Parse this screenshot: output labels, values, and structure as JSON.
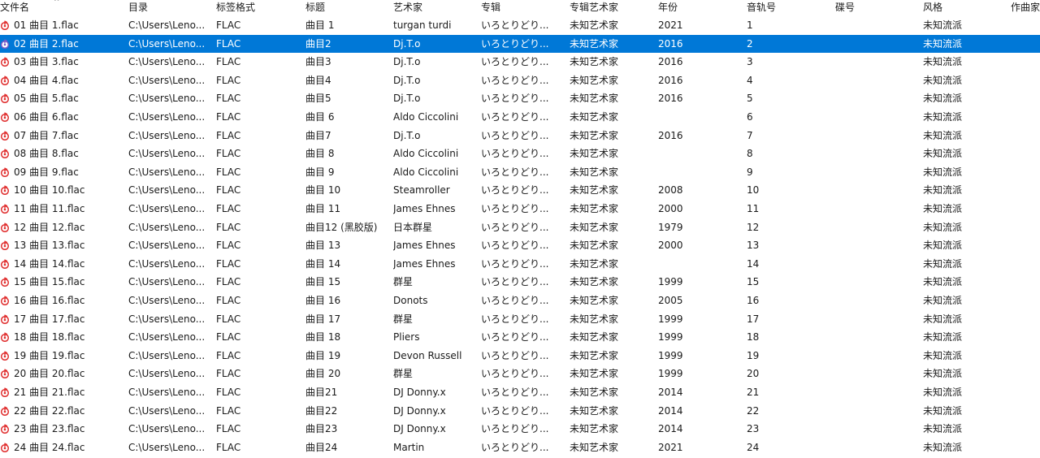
{
  "columns": [
    "文件名",
    "目录",
    "标签格式",
    "标题",
    "艺术家",
    "专辑",
    "专辑艺术家",
    "年份",
    "音轨号",
    "碟号",
    "风格",
    "作曲家"
  ],
  "sort_indicator": "^",
  "icons": {
    "file": "flac-file-icon",
    "file_color": "#e03030",
    "playing_color": "#7a5cc8"
  },
  "colors": {
    "selection": "#0078d7"
  },
  "selected_row": 1,
  "rows": [
    {
      "file": "01 曲目 1.flac",
      "dir": "C:\\Users\\Leno...",
      "fmt": "FLAC",
      "title": "曲目 1",
      "artist": "turgan turdi",
      "album": "いろとりどり...",
      "album_artist": "未知艺术家",
      "year": "2021",
      "track": "1",
      "disc": "",
      "genre": "未知流派",
      "composer": ""
    },
    {
      "file": "02 曲目 2.flac",
      "dir": "C:\\Users\\Leno...",
      "fmt": "FLAC",
      "title": "曲目2",
      "artist": "Dj.T.o",
      "album": "いろとりどり...",
      "album_artist": "未知艺术家",
      "year": "2016",
      "track": "2",
      "disc": "",
      "genre": "未知流派",
      "composer": ""
    },
    {
      "file": "03 曲目 3.flac",
      "dir": "C:\\Users\\Leno...",
      "fmt": "FLAC",
      "title": "曲目3",
      "artist": "Dj.T.o",
      "album": "いろとりどり...",
      "album_artist": "未知艺术家",
      "year": "2016",
      "track": "3",
      "disc": "",
      "genre": "未知流派",
      "composer": ""
    },
    {
      "file": "04 曲目 4.flac",
      "dir": "C:\\Users\\Leno...",
      "fmt": "FLAC",
      "title": "曲目4",
      "artist": "Dj.T.o",
      "album": "いろとりどり...",
      "album_artist": "未知艺术家",
      "year": "2016",
      "track": "4",
      "disc": "",
      "genre": "未知流派",
      "composer": ""
    },
    {
      "file": "05 曲目 5.flac",
      "dir": "C:\\Users\\Leno...",
      "fmt": "FLAC",
      "title": "曲目5",
      "artist": "Dj.T.o",
      "album": "いろとりどり...",
      "album_artist": "未知艺术家",
      "year": "2016",
      "track": "5",
      "disc": "",
      "genre": "未知流派",
      "composer": ""
    },
    {
      "file": "06 曲目 6.flac",
      "dir": "C:\\Users\\Leno...",
      "fmt": "FLAC",
      "title": "曲目 6",
      "artist": "Aldo Ciccolini",
      "album": "いろとりどり...",
      "album_artist": "未知艺术家",
      "year": "",
      "track": "6",
      "disc": "",
      "genre": "未知流派",
      "composer": ""
    },
    {
      "file": "07 曲目 7.flac",
      "dir": "C:\\Users\\Leno...",
      "fmt": "FLAC",
      "title": "曲目7",
      "artist": "Dj.T.o",
      "album": "いろとりどり...",
      "album_artist": "未知艺术家",
      "year": "2016",
      "track": "7",
      "disc": "",
      "genre": "未知流派",
      "composer": ""
    },
    {
      "file": "08 曲目 8.flac",
      "dir": "C:\\Users\\Leno...",
      "fmt": "FLAC",
      "title": "曲目 8",
      "artist": "Aldo Ciccolini",
      "album": "いろとりどり...",
      "album_artist": "未知艺术家",
      "year": "",
      "track": "8",
      "disc": "",
      "genre": "未知流派",
      "composer": ""
    },
    {
      "file": "09 曲目 9.flac",
      "dir": "C:\\Users\\Leno...",
      "fmt": "FLAC",
      "title": "曲目 9",
      "artist": "Aldo Ciccolini",
      "album": "いろとりどり...",
      "album_artist": "未知艺术家",
      "year": "",
      "track": "9",
      "disc": "",
      "genre": "未知流派",
      "composer": ""
    },
    {
      "file": "10 曲目 10.flac",
      "dir": "C:\\Users\\Leno...",
      "fmt": "FLAC",
      "title": "曲目 10",
      "artist": "Steamroller",
      "album": "いろとりどり...",
      "album_artist": "未知艺术家",
      "year": "2008",
      "track": "10",
      "disc": "",
      "genre": "未知流派",
      "composer": ""
    },
    {
      "file": "11 曲目 11.flac",
      "dir": "C:\\Users\\Leno...",
      "fmt": "FLAC",
      "title": "曲目 11",
      "artist": "James Ehnes",
      "album": "いろとりどり...",
      "album_artist": "未知艺术家",
      "year": "2000",
      "track": "11",
      "disc": "",
      "genre": "未知流派",
      "composer": ""
    },
    {
      "file": "12 曲目 12.flac",
      "dir": "C:\\Users\\Leno...",
      "fmt": "FLAC",
      "title": "曲目12 (黑胶版)",
      "artist": "日本群星",
      "album": "いろとりどり...",
      "album_artist": "未知艺术家",
      "year": "1979",
      "track": "12",
      "disc": "",
      "genre": "未知流派",
      "composer": ""
    },
    {
      "file": "13 曲目 13.flac",
      "dir": "C:\\Users\\Leno...",
      "fmt": "FLAC",
      "title": "曲目 13",
      "artist": "James Ehnes",
      "album": "いろとりどり...",
      "album_artist": "未知艺术家",
      "year": "2000",
      "track": "13",
      "disc": "",
      "genre": "未知流派",
      "composer": ""
    },
    {
      "file": "14 曲目 14.flac",
      "dir": "C:\\Users\\Leno...",
      "fmt": "FLAC",
      "title": "曲目 14",
      "artist": "James Ehnes",
      "album": "いろとりどり...",
      "album_artist": "未知艺术家",
      "year": "",
      "track": "14",
      "disc": "",
      "genre": "未知流派",
      "composer": ""
    },
    {
      "file": "15 曲目 15.flac",
      "dir": "C:\\Users\\Leno...",
      "fmt": "FLAC",
      "title": "曲目 15",
      "artist": "群星",
      "album": "いろとりどり...",
      "album_artist": "未知艺术家",
      "year": "1999",
      "track": "15",
      "disc": "",
      "genre": "未知流派",
      "composer": ""
    },
    {
      "file": "16 曲目 16.flac",
      "dir": "C:\\Users\\Leno...",
      "fmt": "FLAC",
      "title": "曲目 16",
      "artist": "Donots",
      "album": "いろとりどり...",
      "album_artist": "未知艺术家",
      "year": "2005",
      "track": "16",
      "disc": "",
      "genre": "未知流派",
      "composer": ""
    },
    {
      "file": "17 曲目 17.flac",
      "dir": "C:\\Users\\Leno...",
      "fmt": "FLAC",
      "title": "曲目 17",
      "artist": "群星",
      "album": "いろとりどり...",
      "album_artist": "未知艺术家",
      "year": "1999",
      "track": "17",
      "disc": "",
      "genre": "未知流派",
      "composer": ""
    },
    {
      "file": "18 曲目 18.flac",
      "dir": "C:\\Users\\Leno...",
      "fmt": "FLAC",
      "title": "曲目 18",
      "artist": "Pliers",
      "album": "いろとりどり...",
      "album_artist": "未知艺术家",
      "year": "1999",
      "track": "18",
      "disc": "",
      "genre": "未知流派",
      "composer": ""
    },
    {
      "file": "19 曲目 19.flac",
      "dir": "C:\\Users\\Leno...",
      "fmt": "FLAC",
      "title": "曲目 19",
      "artist": "Devon Russell",
      "album": "いろとりどり...",
      "album_artist": "未知艺术家",
      "year": "1999",
      "track": "19",
      "disc": "",
      "genre": "未知流派",
      "composer": ""
    },
    {
      "file": "20 曲目 20.flac",
      "dir": "C:\\Users\\Leno...",
      "fmt": "FLAC",
      "title": "曲目 20",
      "artist": "群星",
      "album": "いろとりどり...",
      "album_artist": "未知艺术家",
      "year": "1999",
      "track": "20",
      "disc": "",
      "genre": "未知流派",
      "composer": ""
    },
    {
      "file": "21 曲目 21.flac",
      "dir": "C:\\Users\\Leno...",
      "fmt": "FLAC",
      "title": "曲目21",
      "artist": "DJ Donny.x",
      "album": "いろとりどり...",
      "album_artist": "未知艺术家",
      "year": "2014",
      "track": "21",
      "disc": "",
      "genre": "未知流派",
      "composer": ""
    },
    {
      "file": "22 曲目 22.flac",
      "dir": "C:\\Users\\Leno...",
      "fmt": "FLAC",
      "title": "曲目22",
      "artist": "DJ Donny.x",
      "album": "いろとりどり...",
      "album_artist": "未知艺术家",
      "year": "2014",
      "track": "22",
      "disc": "",
      "genre": "未知流派",
      "composer": ""
    },
    {
      "file": "23 曲目 23.flac",
      "dir": "C:\\Users\\Leno...",
      "fmt": "FLAC",
      "title": "曲目23",
      "artist": "DJ Donny.x",
      "album": "いろとりどり...",
      "album_artist": "未知艺术家",
      "year": "2014",
      "track": "23",
      "disc": "",
      "genre": "未知流派",
      "composer": ""
    },
    {
      "file": "24 曲目 24.flac",
      "dir": "C:\\Users\\Leno...",
      "fmt": "FLAC",
      "title": "曲目24",
      "artist": "Martin",
      "album": "いろとりどり...",
      "album_artist": "未知艺术家",
      "year": "2021",
      "track": "24",
      "disc": "",
      "genre": "未知流派",
      "composer": ""
    }
  ]
}
